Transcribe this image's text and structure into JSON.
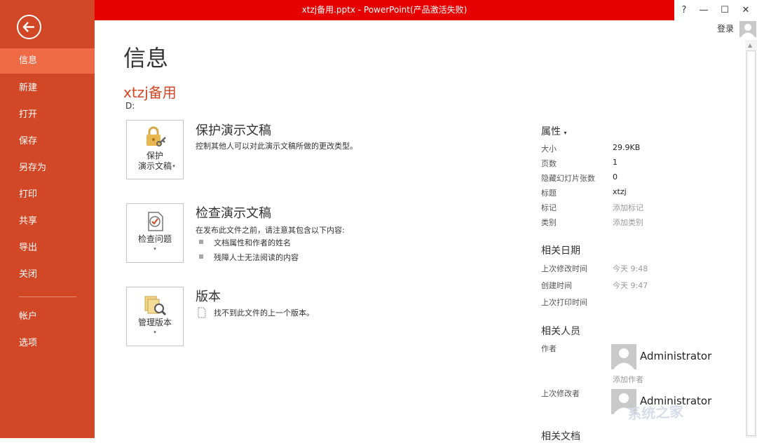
{
  "window": {
    "title": "xtzj备用.pptx - PowerPoint(产品激活失败)",
    "controls": [
      "?",
      "—",
      "☐",
      "✕"
    ],
    "login": "登录"
  },
  "sidebar": {
    "items": [
      "信息",
      "新建",
      "打开",
      "保存",
      "另存为",
      "打印",
      "共享",
      "导出",
      "关闭"
    ],
    "bottom_items": [
      "帐户",
      "选项"
    ]
  },
  "main": {
    "title": "信息",
    "doc_name": "xtzj备用",
    "doc_path": "D:",
    "protect": {
      "button_line1": "保护",
      "button_line2": "演示文稿",
      "caret": "▾",
      "title": "保护演示文稿",
      "desc": "控制其他人可以对此演示文稿所做的更改类型。"
    },
    "inspect": {
      "button_label": "检查问题",
      "caret": "▾",
      "title": "检查演示文稿",
      "desc": "在发布此文件之前，请注意其包含以下内容:",
      "bullets": [
        "文档属性和作者的姓名",
        "残障人士无法阅读的内容"
      ]
    },
    "versions": {
      "button_label": "管理版本",
      "caret": "▾",
      "title": "版本",
      "desc": "找不到此文件的上一个版本。"
    }
  },
  "properties": {
    "header": "属性",
    "header_caret": "▾",
    "rows": [
      {
        "label": "大小",
        "value": "29.9KB"
      },
      {
        "label": "页数",
        "value": "1"
      },
      {
        "label": "隐藏幻灯片张数",
        "value": "0"
      },
      {
        "label": "标题",
        "value": "xtzj"
      },
      {
        "label": "标记",
        "value": "添加标记"
      },
      {
        "label": "类别",
        "value": "添加类别"
      }
    ],
    "dates_header": "相关日期",
    "dates": [
      {
        "label": "上次修改时间",
        "value": "今天 9:48"
      },
      {
        "label": "创建时间",
        "value": "今天 9:47"
      },
      {
        "label": "上次打印时间",
        "value": ""
      }
    ],
    "people_header": "相关人员",
    "author_label": "作者",
    "author_name": "Administrator",
    "add_author": "添加作者",
    "last_modifier_label": "上次修改者",
    "last_modifier_name": "Administrator",
    "related_docs_header": "相关文档"
  },
  "watermark": "系统之家",
  "colors": {
    "sidebar": "#d24726",
    "sidebar_active": "#ef6a45",
    "titlebar": "#e60000",
    "accent_text": "#d24726"
  }
}
